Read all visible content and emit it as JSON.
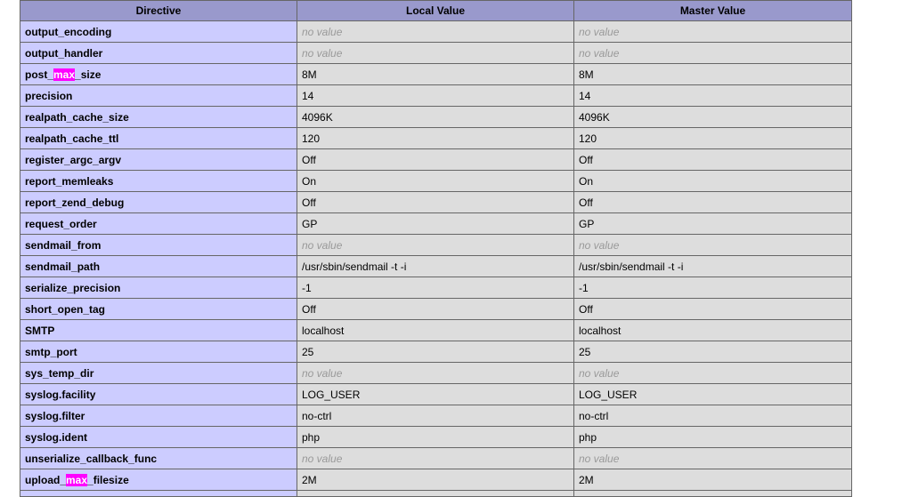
{
  "table": {
    "headers": [
      "Directive",
      "Local Value",
      "Master Value"
    ],
    "highlight_term": "max",
    "rows": [
      {
        "directive": "output_encoding",
        "local": "no value",
        "master": "no value",
        "novalue": true
      },
      {
        "directive": "output_handler",
        "local": "no value",
        "master": "no value",
        "novalue": true
      },
      {
        "directive": "post_max_size",
        "local": "8M",
        "master": "8M",
        "novalue": false
      },
      {
        "directive": "precision",
        "local": "14",
        "master": "14",
        "novalue": false
      },
      {
        "directive": "realpath_cache_size",
        "local": "4096K",
        "master": "4096K",
        "novalue": false
      },
      {
        "directive": "realpath_cache_ttl",
        "local": "120",
        "master": "120",
        "novalue": false
      },
      {
        "directive": "register_argc_argv",
        "local": "Off",
        "master": "Off",
        "novalue": false
      },
      {
        "directive": "report_memleaks",
        "local": "On",
        "master": "On",
        "novalue": false
      },
      {
        "directive": "report_zend_debug",
        "local": "Off",
        "master": "Off",
        "novalue": false
      },
      {
        "directive": "request_order",
        "local": "GP",
        "master": "GP",
        "novalue": false
      },
      {
        "directive": "sendmail_from",
        "local": "no value",
        "master": "no value",
        "novalue": true
      },
      {
        "directive": "sendmail_path",
        "local": "/usr/sbin/sendmail -t -i",
        "master": "/usr/sbin/sendmail -t -i",
        "novalue": false
      },
      {
        "directive": "serialize_precision",
        "local": "-1",
        "master": "-1",
        "novalue": false
      },
      {
        "directive": "short_open_tag",
        "local": "Off",
        "master": "Off",
        "novalue": false
      },
      {
        "directive": "SMTP",
        "local": "localhost",
        "master": "localhost",
        "novalue": false
      },
      {
        "directive": "smtp_port",
        "local": "25",
        "master": "25",
        "novalue": false
      },
      {
        "directive": "sys_temp_dir",
        "local": "no value",
        "master": "no value",
        "novalue": true
      },
      {
        "directive": "syslog.facility",
        "local": "LOG_USER",
        "master": "LOG_USER",
        "novalue": false
      },
      {
        "directive": "syslog.filter",
        "local": "no-ctrl",
        "master": "no-ctrl",
        "novalue": false
      },
      {
        "directive": "syslog.ident",
        "local": "php",
        "master": "php",
        "novalue": false
      },
      {
        "directive": "unserialize_callback_func",
        "local": "no value",
        "master": "no value",
        "novalue": true
      },
      {
        "directive": "upload_max_filesize",
        "local": "2M",
        "master": "2M",
        "novalue": false
      }
    ]
  },
  "colors": {
    "header_bg": "#9999cc",
    "directive_bg": "#ccccff",
    "value_bg": "#dddddd",
    "highlight_bg": "#ff00ff",
    "novalue_text": "#999999",
    "border": "#666666"
  }
}
